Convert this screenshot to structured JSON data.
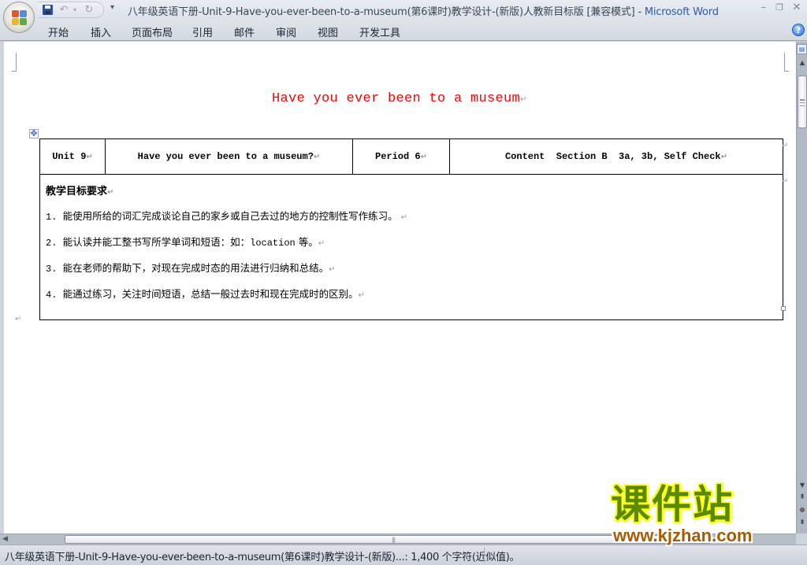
{
  "window": {
    "title_doc": "八年级英语下册-Unit-9-Have-you-ever-been-to-a-museum(第6课时)教学设计-(新版)人教新目标版 [兼容模式]",
    "title_sep": " - ",
    "title_app": "Microsoft Word",
    "minimize": "–",
    "maximize": "❐",
    "close": "✕"
  },
  "quick_access": {
    "undo": "↶",
    "undo_dropdown": "▾",
    "redo": "↻",
    "customize": "▾"
  },
  "ribbon": {
    "tabs": [
      {
        "label": "开始"
      },
      {
        "label": "插入"
      },
      {
        "label": "页面布局"
      },
      {
        "label": "引用"
      },
      {
        "label": "邮件"
      },
      {
        "label": "审阅"
      },
      {
        "label": "视图"
      },
      {
        "label": "开发工具"
      }
    ],
    "help": "?"
  },
  "document": {
    "title": "Have you ever been to a museum",
    "para_mark": "↵",
    "table_move_glyph": "✥",
    "table": {
      "header": {
        "unit": "Unit 9",
        "topic": "Have you ever been to a museum?",
        "period": "Period 6",
        "content": "Content  Section B  3a, 3b, Self Check"
      },
      "objectives_title": "教学目标要求",
      "objectives": [
        {
          "prefix": "1. ",
          "text": "能使用所给的词汇完成谈论自己的家乡或自己去过的地方的控制性写作练习。 "
        },
        {
          "prefix": "2. ",
          "text_before": "能认读并能工整书写所学单词和短语：如：",
          "mono": "location",
          "text_after": " 等。"
        },
        {
          "prefix": "3. ",
          "text": "能在老师的帮助下，对现在完成时态的用法进行归纳和总结。"
        },
        {
          "prefix": "4. ",
          "text": "能通过练习，关注时间短语，总结一般过去时和现在完成时的区别。"
        }
      ]
    }
  },
  "scrollbars": {
    "up": "▲",
    "down": "▼",
    "prev_page": "⯭",
    "select_browse": "●",
    "next_page": "⯯",
    "left": "◀",
    "grip": "|||"
  },
  "statusbar": {
    "text": "八年级英语下册-Unit-9-Have-you-ever-been-to-a-museum(第6课时)教学设计-(新版)...: 1,400 个字符(近似值)。"
  },
  "watermark": {
    "cn": "课件站",
    "url": "www.kjzhan.com"
  }
}
